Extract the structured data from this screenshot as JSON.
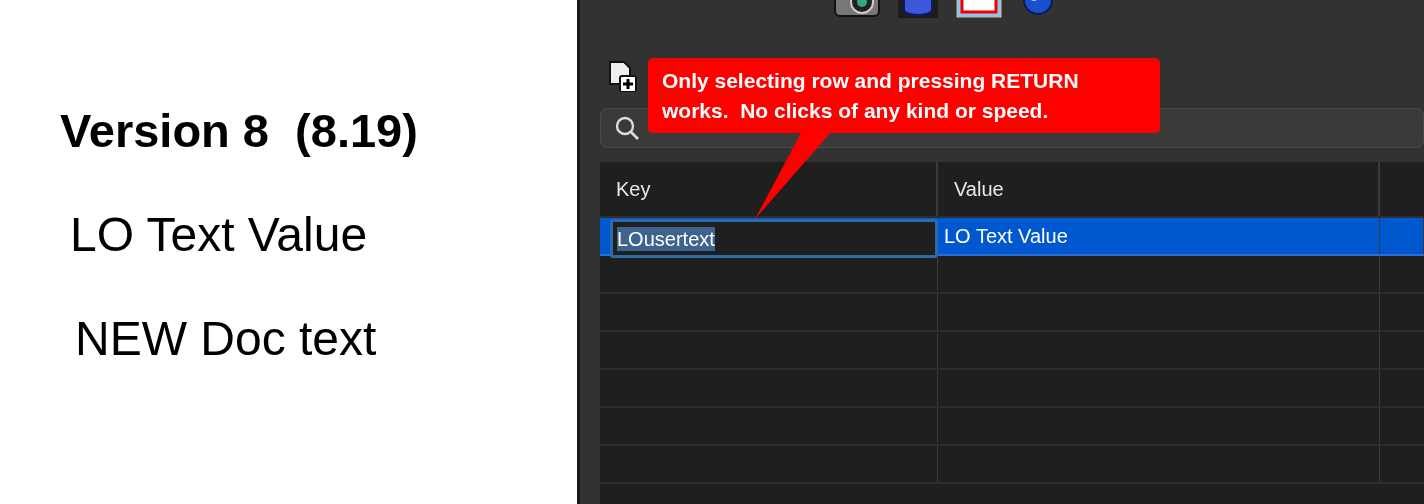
{
  "slide": {
    "lines": [
      {
        "text": "Version 8  (8.19)",
        "kind": "heading"
      },
      {
        "text": "LO Text Value",
        "kind": "body"
      },
      {
        "text": "NEW Doc text",
        "kind": "body"
      }
    ]
  },
  "callout": {
    "text": "Only selecting row and pressing RETURN works.  No clicks of any kind or speed."
  },
  "table": {
    "columns": [
      "Key",
      "Value"
    ],
    "rows": [
      {
        "key": "LOusertext",
        "value": "LO Text Value",
        "selected": true,
        "editing": true
      }
    ]
  }
}
